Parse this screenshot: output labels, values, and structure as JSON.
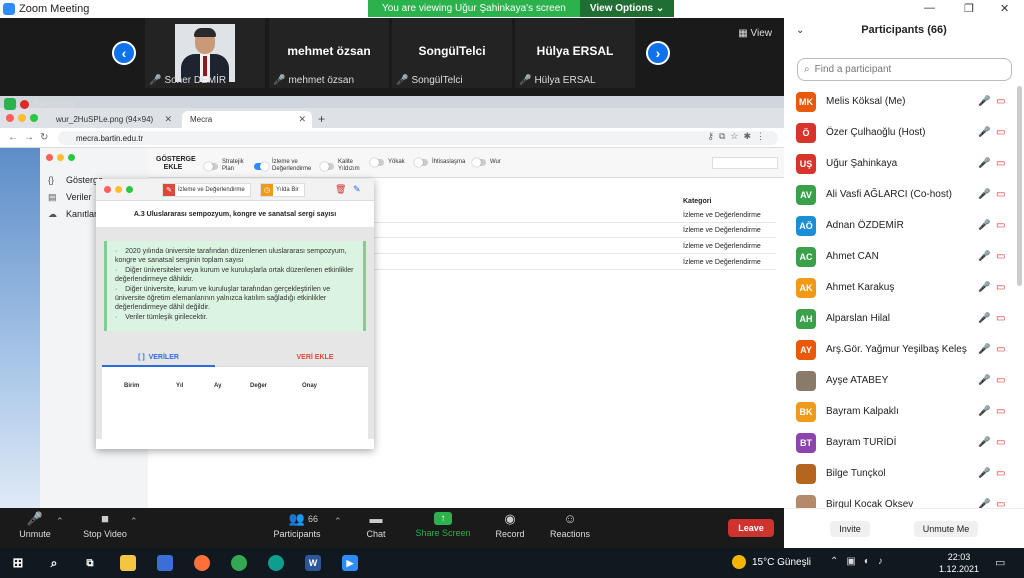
{
  "window": {
    "title": "Zoom Meeting"
  },
  "banner": {
    "text": "You are viewing Uğur Şahinkaya's screen",
    "view_options": "View Options"
  },
  "video_strip": {
    "tiles": [
      {
        "name": "",
        "label": "Soner DEMİR"
      },
      {
        "name": "mehmet özsan",
        "label": "mehmet özsan"
      },
      {
        "name": "SongülTelci",
        "label": "SongülTelci"
      },
      {
        "name": "Hülya ERSAL",
        "label": "Hülya ERSAL"
      }
    ],
    "view_label": "View"
  },
  "recording": "Recording",
  "browser": {
    "tabs": [
      "wur_2HuSPLe.png (94×94)",
      "Mecra"
    ],
    "url": "mecra.bartin.edu.tr"
  },
  "app": {
    "sidebar": [
      "Gösterge",
      "Veriler",
      "Kanıtlar"
    ],
    "filter_title": "GÖSTERGE EKLE",
    "toggles": [
      {
        "label": "Stratejik Plan",
        "on": false
      },
      {
        "label": "İzleme ve Değerlendirme",
        "on": true
      },
      {
        "label": "Kalite Yıldızım",
        "on": false
      },
      {
        "label": "Yökak",
        "on": false
      },
      {
        "label": "İhtisaslaşma",
        "on": false
      },
      {
        "label": "Wur",
        "on": false
      }
    ],
    "category_header": "Kategori",
    "rows": [
      "İzleme ve Değerlendirme",
      "İzleme ve Değerlendirme",
      "İzleme ve Değerlendirme",
      "İzleme ve Değerlendirme"
    ]
  },
  "modal": {
    "tab1": "İzleme ve Değerlendirme",
    "tab2": "Yılda Bir",
    "title": "A.3 Uluslararası sempozyum, kongre ve sanatsal sergi sayısı",
    "info": [
      "2020 yılında üniversite tarafından düzenlenen uluslararası sempozyum, kongre ve sanatsal serginin toplam sayısı",
      "Diğer üniversiteler veya kurum ve kuruluşlarla ortak düzenlenen etkinlikler değerlendirmeye dâhildir.",
      "Diğer üniversite, kurum ve kuruluşlar tarafından gerçekleştirilen ve üniversite öğretim elemanlarının yalnızca katılım sağladığı etkinlikler değerlendirmeye dâhil değildir.",
      "Veriler tümleşik girilecektir."
    ],
    "tab_veriler": "VERİLER",
    "tab_ekle": "VERİ EKLE",
    "columns": [
      "Birim",
      "Yıl",
      "Ay",
      "Değer",
      "Onay"
    ]
  },
  "toolbar": {
    "unmute": "Unmute",
    "stop_video": "Stop Video",
    "participants": "Participants",
    "participants_count": "66",
    "chat": "Chat",
    "share": "Share Screen",
    "record": "Record",
    "reactions": "Reactions",
    "leave": "Leave"
  },
  "panel": {
    "title": "Participants (66)",
    "search_placeholder": "Find a participant",
    "participants": [
      {
        "initials": "MK",
        "name": "Melis Köksal (Me)",
        "color": "#e8590c"
      },
      {
        "initials": "Ö",
        "name": "Özer Çulhaoğlu (Host)",
        "color": "#d9342b"
      },
      {
        "initials": "UŞ",
        "name": "Uğur Şahinkaya",
        "color": "#d9342b"
      },
      {
        "initials": "AV",
        "name": "Ali Vasfi AĞLARCI (Co-host)",
        "color": "#3aa04a"
      },
      {
        "initials": "AÖ",
        "name": "Adnan ÖZDEMİR",
        "color": "#1a8fd6"
      },
      {
        "initials": "AC",
        "name": "Ahmet CAN",
        "color": "#3aa04a"
      },
      {
        "initials": "AK",
        "name": "Ahmet Karakuş",
        "color": "#f09a1a"
      },
      {
        "initials": "AH",
        "name": "Alparslan Hilal",
        "color": "#3aa04a"
      },
      {
        "initials": "AY",
        "name": "Arş.Gör. Yağmur Yeşilbaş Keleş",
        "color": "#e8590c"
      },
      {
        "initials": "",
        "name": "Ayşe ATABEY",
        "color": "#8a7a6a"
      },
      {
        "initials": "BK",
        "name": "Bayram Kalpaklı",
        "color": "#f09a1a"
      },
      {
        "initials": "BT",
        "name": "Bayram TURİDİ",
        "color": "#8e44ad"
      },
      {
        "initials": "",
        "name": "Bilge Tunçkol",
        "color": "#b5651d"
      },
      {
        "initials": "",
        "name": "Birgul Kocak Oksev",
        "color": "#b58a6a"
      }
    ],
    "invite": "Invite",
    "unmute_me": "Unmute Me"
  },
  "taskbar": {
    "weather": "15°C Güneşli",
    "time": "22:03",
    "date": "1.12.2021"
  }
}
